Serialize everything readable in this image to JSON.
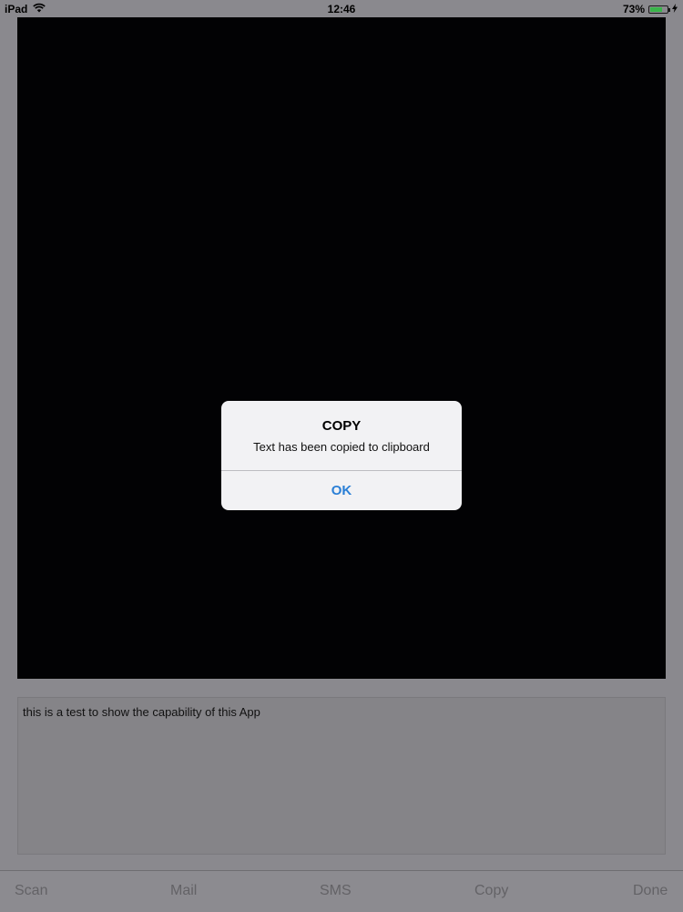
{
  "status_bar": {
    "device": "iPad",
    "time": "12:46",
    "battery": "73%",
    "battery_level": 0.73,
    "wifi_icon": "wifi-icon",
    "charging_icon": "bolt-icon"
  },
  "scanner": {
    "recognized_text": "this is a test to show the capability of this App"
  },
  "toolbar": {
    "scan_label": "Scan",
    "mail_label": "Mail",
    "sms_label": "SMS",
    "copy_label": "Copy",
    "done_label": "Done"
  },
  "alert": {
    "title": "COPY",
    "message": "Text has been copied to clipboard",
    "ok_label": "OK"
  },
  "colors": {
    "alert_button": "#2a7fd6",
    "battery": "#3ab54a"
  }
}
